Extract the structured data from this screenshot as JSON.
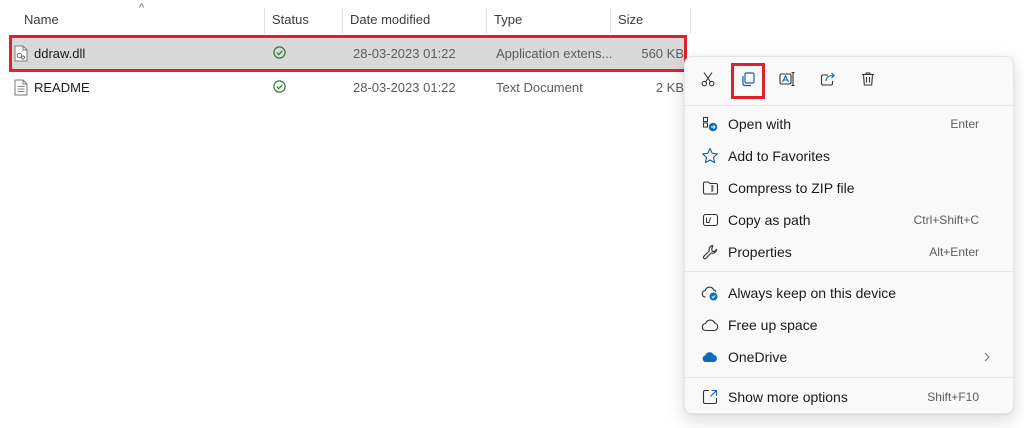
{
  "columns": {
    "name": "Name",
    "status": "Status",
    "date_modified": "Date modified",
    "type": "Type",
    "size": "Size"
  },
  "files": [
    {
      "name": "ddraw.dll",
      "status_icon": "synced-check-icon",
      "date_modified": "28-03-2023 01:22",
      "type": "Application extens...",
      "size": "560 KB",
      "selected": true
    },
    {
      "name": "README",
      "status_icon": "synced-check-icon",
      "date_modified": "28-03-2023 01:22",
      "type": "Text Document",
      "size": "2 KB",
      "selected": false
    }
  ],
  "context_menu": {
    "toolbar": [
      {
        "icon": "cut-icon"
      },
      {
        "icon": "copy-icon",
        "highlighted": true
      },
      {
        "icon": "rename-icon"
      },
      {
        "icon": "share-icon"
      },
      {
        "icon": "delete-icon"
      }
    ],
    "groups": [
      [
        {
          "label": "Open with",
          "icon": "open-with-icon",
          "shortcut": "Enter"
        },
        {
          "label": "Add to Favorites",
          "icon": "star-icon",
          "shortcut": ""
        },
        {
          "label": "Compress to ZIP file",
          "icon": "zip-icon",
          "shortcut": ""
        },
        {
          "label": "Copy as path",
          "icon": "copy-path-icon",
          "shortcut": "Ctrl+Shift+C"
        },
        {
          "label": "Properties",
          "icon": "wrench-icon",
          "shortcut": "Alt+Enter"
        }
      ],
      [
        {
          "label": "Always keep on this device",
          "icon": "cloud-pin-icon",
          "shortcut": ""
        },
        {
          "label": "Free up space",
          "icon": "cloud-icon",
          "shortcut": ""
        },
        {
          "label": "OneDrive",
          "icon": "onedrive-icon",
          "shortcut": "",
          "submenu": true
        }
      ],
      [
        {
          "label": "Show more options",
          "icon": "more-options-icon",
          "shortcut": "Shift+F10"
        }
      ]
    ]
  },
  "colors": {
    "highlight_border": "#e0202b",
    "selected_row": "#d9d9d9",
    "sync_green": "#2e7d32",
    "onedrive_blue": "#0f6cbd"
  }
}
